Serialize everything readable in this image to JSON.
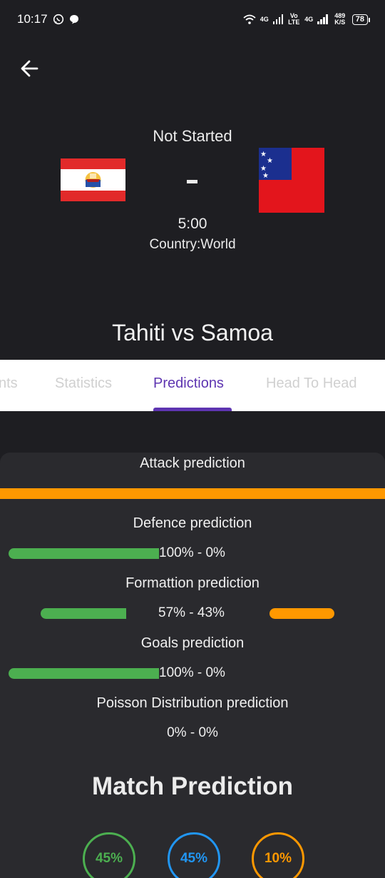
{
  "status_bar": {
    "time": "10:17",
    "net_left": "4G",
    "volte": "Vo LTE",
    "net_right": "4G",
    "speed": "489 K/S",
    "battery": "78"
  },
  "match": {
    "status": "Not Started",
    "score": "-",
    "time": "5:00",
    "country": "Country:World",
    "title": "Tahiti vs Samoa"
  },
  "tabs": [
    "nts",
    "Statistics",
    "Predictions",
    "Head To Head"
  ],
  "active_tab": "Predictions",
  "predictions": {
    "attack_label": "Attack prediction",
    "defence_label": "Defence prediction",
    "defence_value": "100% - 0%",
    "defence_home": 1.0,
    "formation_label": "Formattion prediction",
    "formation_value": "57% - 43%",
    "formation_home": 0.57,
    "formation_away": 0.43,
    "goals_label": "Goals prediction",
    "goals_value": "100% - 0%",
    "goals_home": 1.0,
    "poisson_label": "Poisson Distribution prediction",
    "poisson_value": "0% - 0%"
  },
  "match_prediction": {
    "title": "Match Prediction",
    "home": "45%",
    "draw": "45%",
    "away": "10%"
  },
  "colors": {
    "accent": "#5e35b1",
    "home": "#4caf50",
    "draw": "#2196f3",
    "away": "#ff9800",
    "background": "#1e1e22"
  }
}
